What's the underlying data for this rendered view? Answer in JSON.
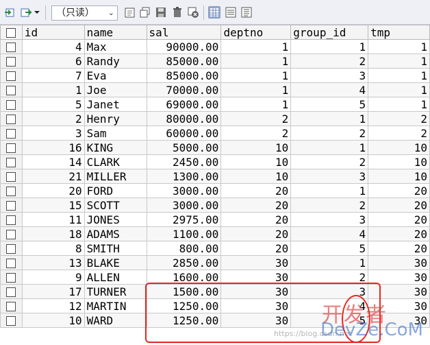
{
  "toolbar": {
    "mode_select": "（只读）",
    "icons": [
      "import-icon",
      "export-icon",
      "dropdown-arrow-icon",
      "filter-icon",
      "copy-row-icon",
      "save-icon",
      "delete-icon",
      "cancel-icon",
      "grid-view-icon",
      "form-view-icon",
      "text-view-icon"
    ]
  },
  "grid": {
    "columns": [
      "id",
      "name",
      "sal",
      "deptno",
      "group_id",
      "tmp"
    ],
    "rows": [
      [
        "4",
        "Max",
        "90000.00",
        "1",
        "1",
        "1"
      ],
      [
        "6",
        "Randy",
        "85000.00",
        "1",
        "2",
        "1"
      ],
      [
        "7",
        "Eva",
        "85000.00",
        "1",
        "3",
        "1"
      ],
      [
        "1",
        "Joe",
        "70000.00",
        "1",
        "4",
        "1"
      ],
      [
        "5",
        "Janet",
        "69000.00",
        "1",
        "5",
        "1"
      ],
      [
        "2",
        "Henry",
        "80000.00",
        "2",
        "1",
        "2"
      ],
      [
        "3",
        "Sam",
        "60000.00",
        "2",
        "2",
        "2"
      ],
      [
        "16",
        "KING",
        "5000.00",
        "10",
        "1",
        "10"
      ],
      [
        "14",
        "CLARK",
        "2450.00",
        "10",
        "2",
        "10"
      ],
      [
        "21",
        "MILLER",
        "1300.00",
        "10",
        "3",
        "10"
      ],
      [
        "20",
        "FORD",
        "3000.00",
        "20",
        "1",
        "20"
      ],
      [
        "15",
        "SCOTT",
        "3000.00",
        "20",
        "2",
        "20"
      ],
      [
        "11",
        "JONES",
        "2975.00",
        "20",
        "3",
        "20"
      ],
      [
        "18",
        "ADAMS",
        "1100.00",
        "20",
        "4",
        "20"
      ],
      [
        "8",
        "SMITH",
        "800.00",
        "20",
        "5",
        "20"
      ],
      [
        "13",
        "BLAKE",
        "2850.00",
        "30",
        "1",
        "30"
      ],
      [
        "9",
        "ALLEN",
        "1600.00",
        "30",
        "2",
        "30"
      ],
      [
        "17",
        "TURNER",
        "1500.00",
        "30",
        "3",
        "30"
      ],
      [
        "12",
        "MARTIN",
        "1250.00",
        "30",
        "4",
        "30"
      ],
      [
        "10",
        "WARD",
        "1250.00",
        "30",
        "5",
        "30"
      ]
    ]
  },
  "watermark": {
    "cn": "开发者",
    "en": "DevZe.CoM",
    "url": "https://blog.csdn.net"
  },
  "colors": {
    "annotation": "#e8261f",
    "toolbar_bg": "#eef0f6"
  }
}
